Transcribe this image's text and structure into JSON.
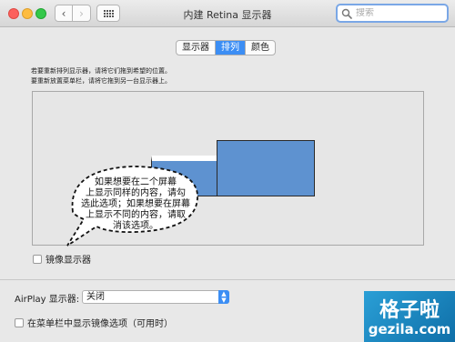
{
  "window": {
    "title": "内建 Retina 显示器"
  },
  "toolbar": {
    "back_glyph": "‹",
    "forward_glyph": "›"
  },
  "search": {
    "placeholder": "搜索"
  },
  "tabs": [
    {
      "label": "显示器",
      "active": false
    },
    {
      "label": "排列",
      "active": true
    },
    {
      "label": "颜色",
      "active": false
    }
  ],
  "instructions": {
    "line1": "若要重新排列显示器，请将它们拖到希望的位置。",
    "line2": "要重新放置菜单栏，请将它拖到另一台显示器上。"
  },
  "callout": {
    "lines": [
      "如果想要在二个屏幕",
      "上显示同样的内容，请勾",
      "选此选项；如果想要在屏幕",
      "上显示不同的内容，请取",
      "消该选项。"
    ]
  },
  "mirror_displays": {
    "label": "镜像显示器",
    "checked": false
  },
  "airplay": {
    "label": "AirPlay 显示器:",
    "selected": "关闭"
  },
  "menubar_option": {
    "label": "在菜单栏中显示镜像选项（可用时）",
    "checked": false
  },
  "watermark": {
    "line1": "格子啦",
    "line2": "gezila.com"
  },
  "icons": {
    "search": "search-icon",
    "grid": "grid-icon",
    "select": "updown-arrows-icon"
  },
  "colors": {
    "accent": "#3c8ef4",
    "display_fill": "#5e92d0",
    "close": "#fc605c",
    "minimize": "#fdbc40",
    "zoom": "#34c84a",
    "watermark": "#1f8cc9"
  }
}
